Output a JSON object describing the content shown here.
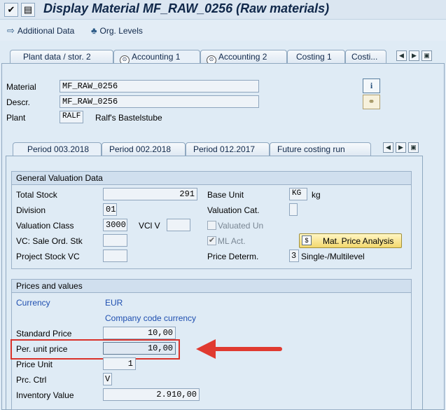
{
  "window": {
    "title": "Display Material MF_RAW_0256 (Raw materials)"
  },
  "app_toolbar": {
    "additional_data": "Additional Data",
    "org_levels": "Org. Levels"
  },
  "main_tabs": [
    {
      "label": "Plant data / stor. 2"
    },
    {
      "label": "Accounting 1"
    },
    {
      "label": "Accounting 2"
    },
    {
      "label": "Costing 1"
    },
    {
      "label": "Costi..."
    }
  ],
  "header": {
    "material_label": "Material",
    "material_value": "MF_RAW_0256",
    "descr_label": "Descr.",
    "descr_value": "MF_RAW_0256",
    "plant_label": "Plant",
    "plant_code": "RALF",
    "plant_name": "Ralf's Bastelstube"
  },
  "period_tabs": [
    {
      "label": "Period 003.2018"
    },
    {
      "label": "Period 002.2018"
    },
    {
      "label": "Period 012.2017"
    },
    {
      "label": "Future costing run"
    }
  ],
  "general_valuation": {
    "title": "General Valuation Data",
    "total_stock_label": "Total Stock",
    "total_stock_value": "291",
    "base_unit_label": "Base Unit",
    "base_unit_value": "KG",
    "base_unit_text": "kg",
    "division_label": "Division",
    "division_value": "01",
    "valuation_cat_label": "Valuation Cat.",
    "valuation_class_label": "Valuation Class",
    "valuation_class_value": "3000",
    "vcl_v_label": "VCl V",
    "valuated_un_label": "Valuated Un",
    "vc_sale_label": "VC: Sale Ord. Stk",
    "ml_act_label": "ML Act.",
    "ml_act_checked": true,
    "mat_price_analysis": "Mat. Price Analysis",
    "project_stock_label": "Project Stock VC",
    "price_determ_label": "Price Determ.",
    "price_determ_value": "3",
    "price_determ_text": "Single-/Multilevel"
  },
  "prices": {
    "title": "Prices and values",
    "currency_label": "Currency",
    "currency_value": "EUR",
    "currency_text": "Company code currency",
    "standard_price_label": "Standard Price",
    "standard_price_value": "10,00",
    "per_unit_price_label": "Per. unit price",
    "per_unit_price_value": "10,00",
    "price_unit_label": "Price Unit",
    "price_unit_value": "1",
    "prc_ctrl_label": "Prc. Ctrl",
    "prc_ctrl_value": "V",
    "inventory_value_label": "Inventory Value",
    "inventory_value_value": "2.910,00"
  },
  "colors": {
    "highlight_box": "#d9322a",
    "arrow": "#e03a30",
    "link_blue": "#1f4fb0",
    "title_color": "#10284a"
  },
  "icons": [
    "save-icon",
    "additional-data-icon",
    "org-levels-icon",
    "accounting-tab-icon",
    "info-icon",
    "link-icon",
    "scroll-left-icon",
    "scroll-right-icon",
    "tab-menu-icon",
    "price-analysis-icon"
  ]
}
